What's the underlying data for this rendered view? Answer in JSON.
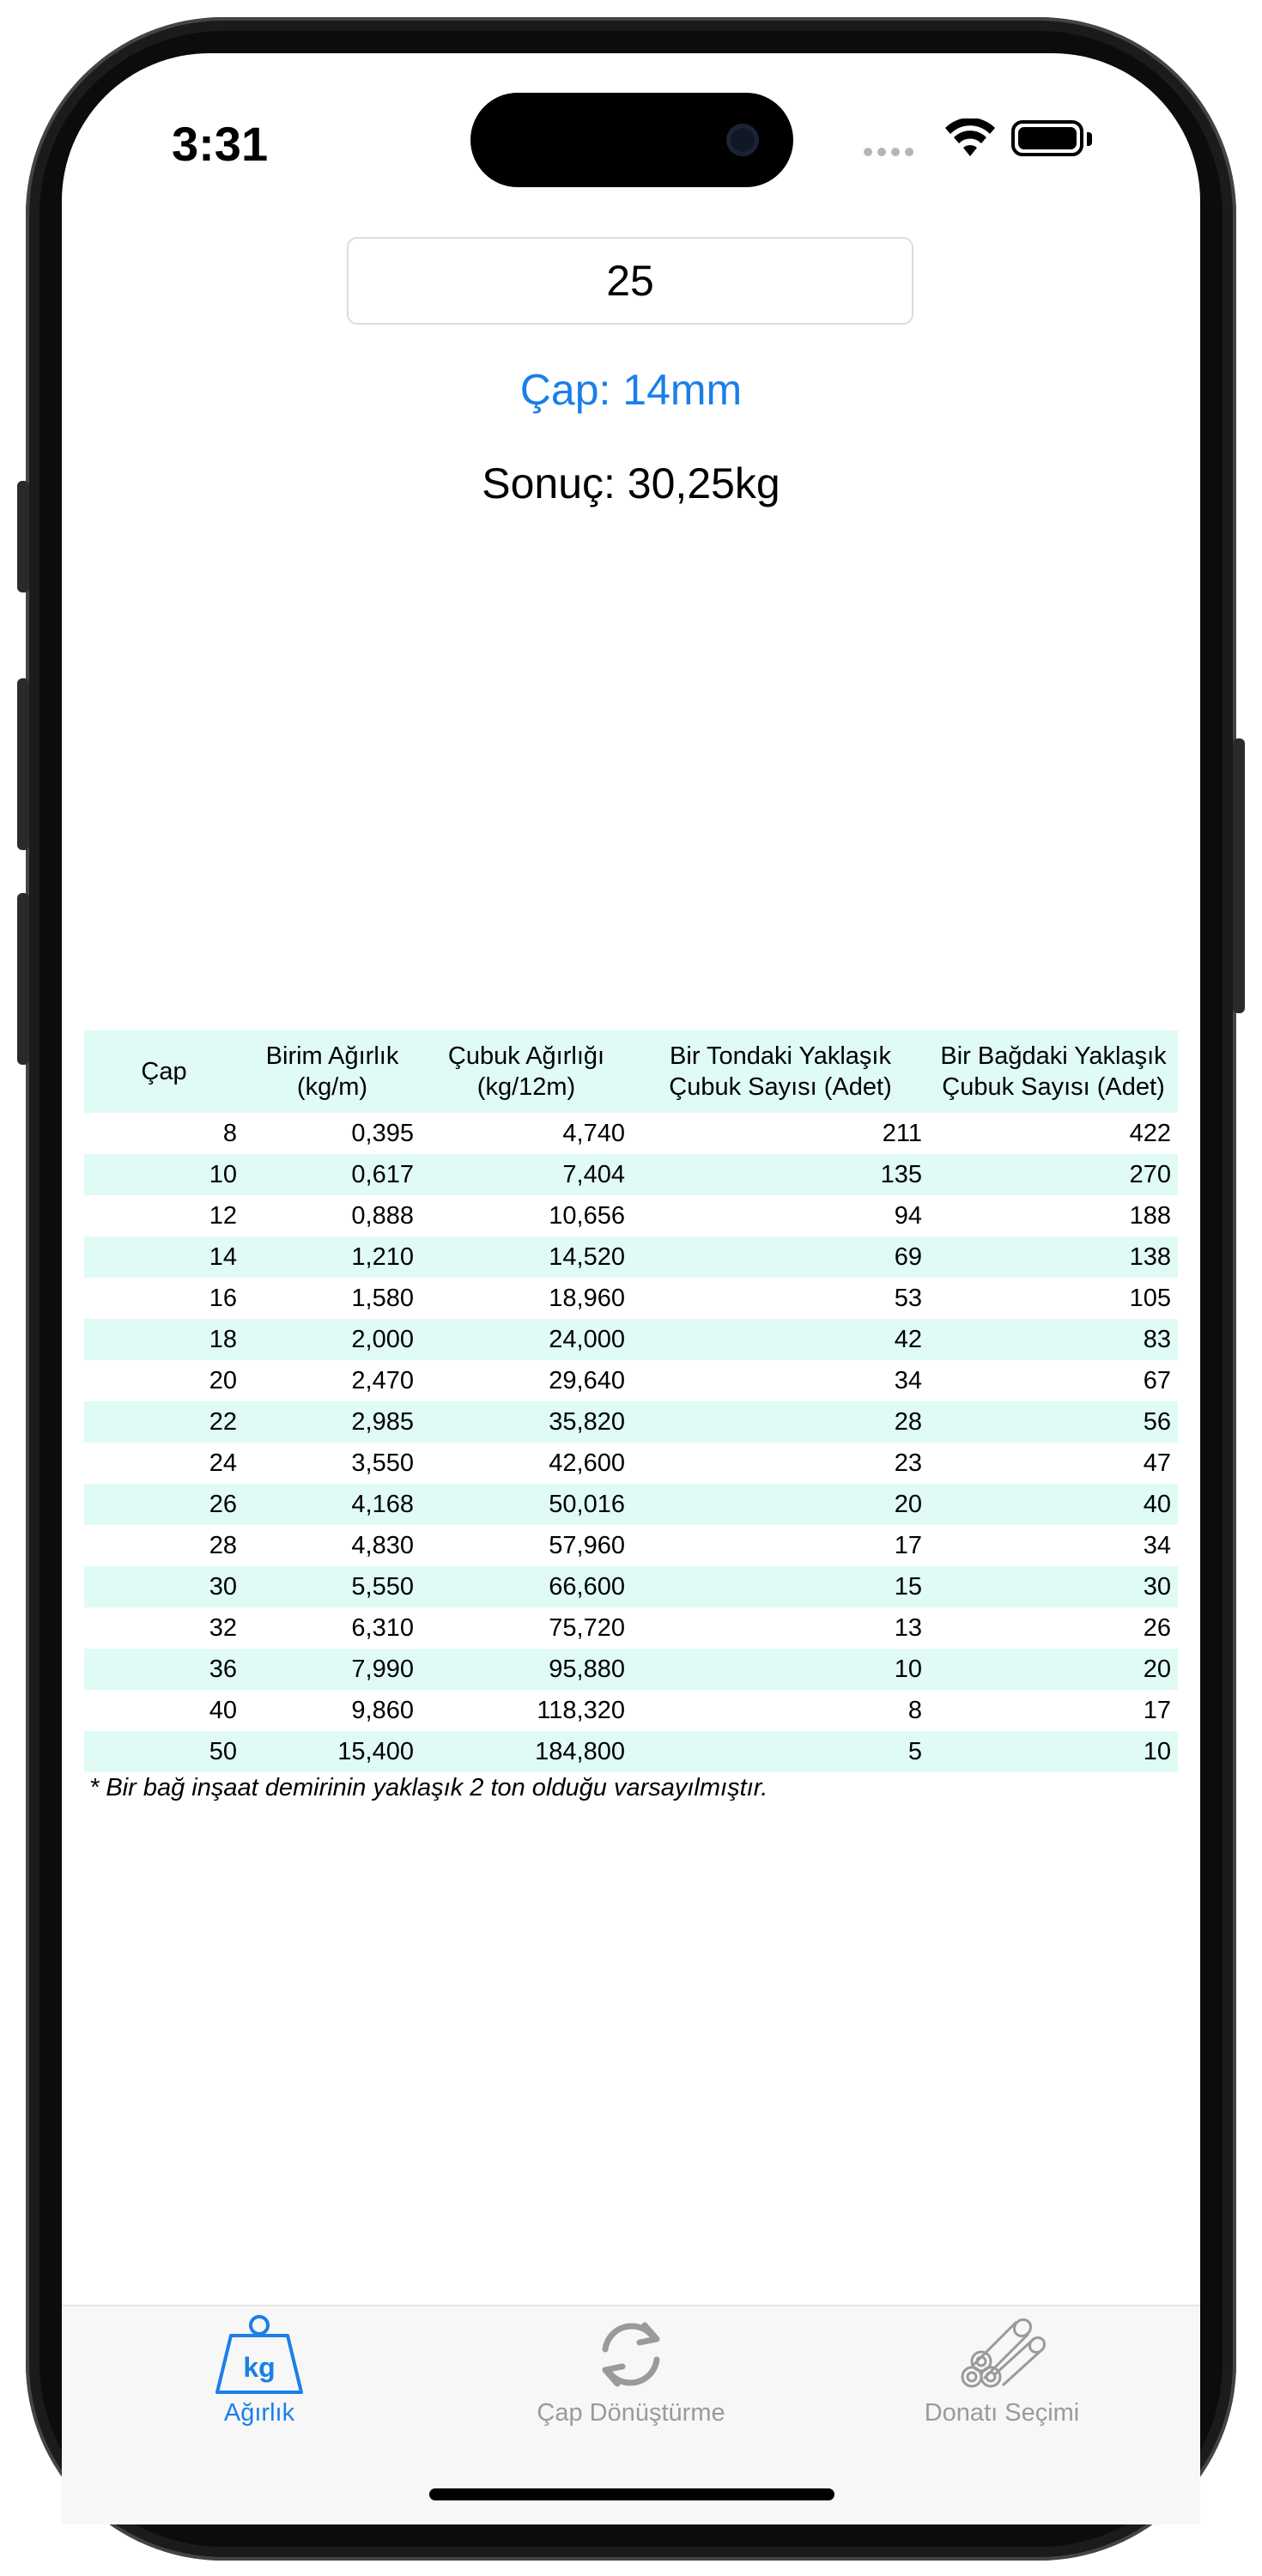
{
  "status_bar": {
    "time": "3:31"
  },
  "input": {
    "value": "25"
  },
  "selected_diameter": "Çap: 14mm",
  "result": "Sonuç: 30,25kg",
  "table": {
    "headers": [
      "Çap",
      "Birim Ağırlık (kg/m)",
      "Çubuk Ağırlığı (kg/12m)",
      "Bir Tondaki Yaklaşık Çubuk Sayısı (Adet)",
      "Bir Bağdaki Yaklaşık Çubuk Sayısı (Adet)"
    ],
    "rows": [
      [
        "8",
        "0,395",
        "4,740",
        "211",
        "422"
      ],
      [
        "10",
        "0,617",
        "7,404",
        "135",
        "270"
      ],
      [
        "12",
        "0,888",
        "10,656",
        "94",
        "188"
      ],
      [
        "14",
        "1,210",
        "14,520",
        "69",
        "138"
      ],
      [
        "16",
        "1,580",
        "18,960",
        "53",
        "105"
      ],
      [
        "18",
        "2,000",
        "24,000",
        "42",
        "83"
      ],
      [
        "20",
        "2,470",
        "29,640",
        "34",
        "67"
      ],
      [
        "22",
        "2,985",
        "35,820",
        "28",
        "56"
      ],
      [
        "24",
        "3,550",
        "42,600",
        "23",
        "47"
      ],
      [
        "26",
        "4,168",
        "50,016",
        "20",
        "40"
      ],
      [
        "28",
        "4,830",
        "57,960",
        "17",
        "34"
      ],
      [
        "30",
        "5,550",
        "66,600",
        "15",
        "30"
      ],
      [
        "32",
        "6,310",
        "75,720",
        "13",
        "26"
      ],
      [
        "36",
        "7,990",
        "95,880",
        "10",
        "20"
      ],
      [
        "40",
        "9,860",
        "118,320",
        "8",
        "17"
      ],
      [
        "50",
        "15,400",
        "184,800",
        "5",
        "10"
      ]
    ],
    "note": "* Bir bağ inşaat demirinin yaklaşık 2 ton olduğu varsayılmıştır."
  },
  "tabbar": {
    "tabs": [
      {
        "label": "Ağırlık",
        "icon": "kg-weight-icon",
        "active": true,
        "icon_text": "kg"
      },
      {
        "label": "Çap Dönüştürme",
        "icon": "refresh-icon",
        "active": false
      },
      {
        "label": "Donatı Seçimi",
        "icon": "rebar-bundle-icon",
        "active": false
      }
    ]
  },
  "colors": {
    "accent": "#1a7fe8",
    "row_stripe": "#e0fbf5",
    "inactive_tab": "#9a9a9a"
  }
}
